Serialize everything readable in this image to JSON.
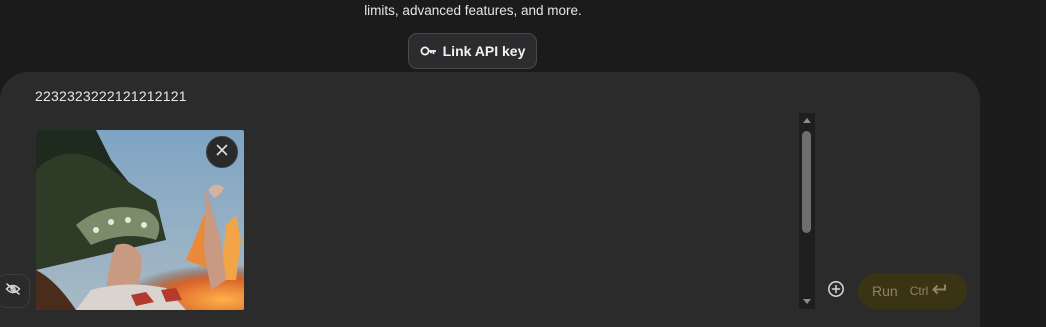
{
  "notice": {
    "text": "limits, advanced features, and more."
  },
  "link_api_key": {
    "label": "Link API key",
    "icon": "key-icon"
  },
  "prompt": {
    "text": "2232323222121212121"
  },
  "attachment": {
    "remove_icon": "close-icon"
  },
  "actions": {
    "add_icon": "add-circle-icon",
    "run_label": "Run",
    "run_shortcut": "Ctrl",
    "run_shortcut_icon": "enter-icon"
  },
  "sidebar_toggle": {
    "icon": "visibility-off-icon"
  },
  "colors": {
    "background": "#1b1b1c",
    "panel": "#2b2b2c",
    "run_button_bg": "#3b3414",
    "run_button_text": "#8c8463"
  }
}
